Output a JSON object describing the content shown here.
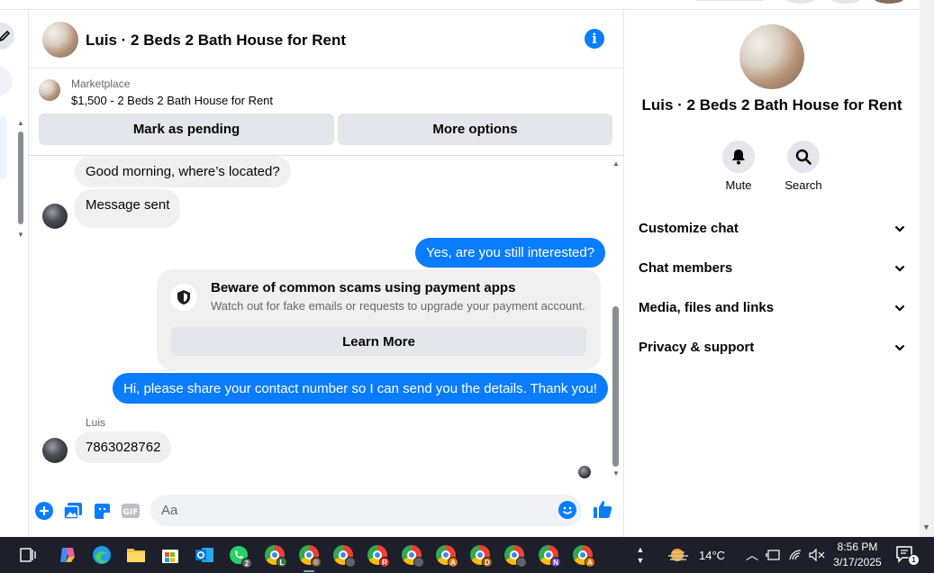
{
  "conversation": {
    "title": "Luis · 2 Beds 2 Bath House for Rent",
    "info_icon": "info-icon"
  },
  "marketplace": {
    "label": "Marketplace",
    "listing": "$1,500 - 2 Beds 2 Bath House for Rent",
    "mark_pending": "Mark as pending",
    "more_options": "More options"
  },
  "messages": {
    "m1": "Good morning, where’s located?",
    "m2": "Message sent",
    "m3": "Yes, are you still interested?",
    "scam_title": "Beware of common scams using payment apps",
    "scam_subtitle": "Watch out for fake emails or requests to upgrade your payment account.",
    "learn_more": "Learn More",
    "m4": "Hi, please share your contact number so I can send you the details. Thank you!",
    "sender": "Luis",
    "m5": "7863028762"
  },
  "composer": {
    "placeholder": "Aa"
  },
  "sidebar": {
    "name": "Luis · 2 Beds 2 Bath House for Rent",
    "mute": "Mute",
    "search": "Search",
    "rows": [
      "Customize chat",
      "Chat members",
      "Media, files and links",
      "Privacy & support"
    ]
  },
  "taskbar": {
    "whatsapp_badge": "2",
    "weather": "14°C",
    "time": "8:56 PM",
    "date": "3/17/2025",
    "notifications": "1",
    "chrome_profiles": [
      "L",
      "©",
      "",
      "R",
      "",
      "A",
      "D",
      "",
      "N",
      "A"
    ]
  },
  "colors": {
    "accent": "#0a7cff",
    "taskbar": "#1d1f2a",
    "bubble_in": "#f0f0f0"
  }
}
